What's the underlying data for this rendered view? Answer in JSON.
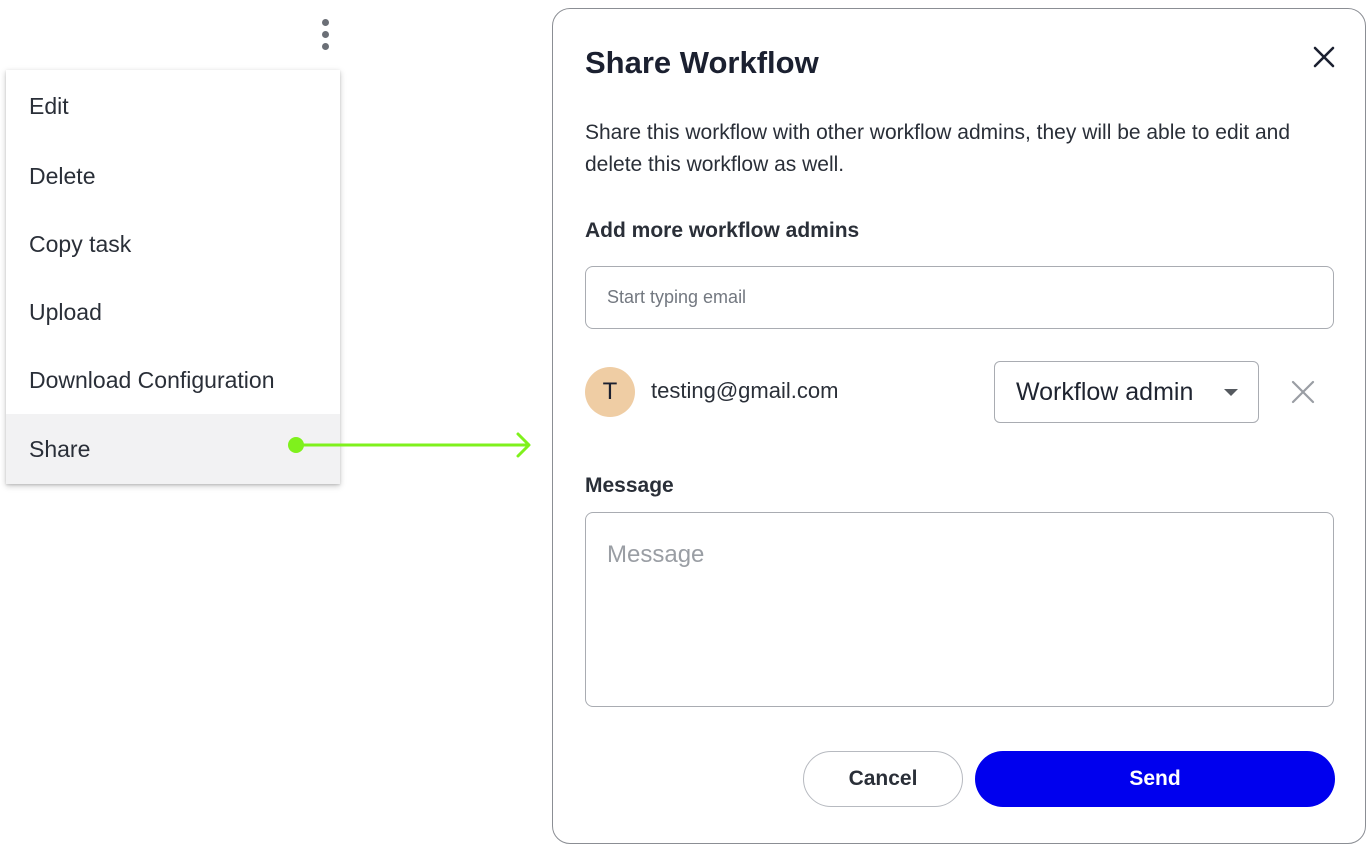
{
  "menu": {
    "items": [
      {
        "label": "Edit"
      },
      {
        "label": "Delete"
      },
      {
        "label": "Copy task"
      },
      {
        "label": "Upload"
      },
      {
        "label": "Download Configuration"
      },
      {
        "label": "Share"
      }
    ],
    "active_item": "Share"
  },
  "dialog": {
    "title": "Share Workflow",
    "description": "Share this workflow with other workflow admins, they will be able to edit and delete this workflow as well.",
    "admins_label": "Add more workflow admins",
    "email_placeholder": "Start typing email",
    "user": {
      "initial": "T",
      "email": "testing@gmail.com",
      "role": "Workflow admin"
    },
    "message_label": "Message",
    "message_placeholder": "Message",
    "cancel_label": "Cancel",
    "send_label": "Send"
  },
  "colors": {
    "primary": "#0000ee",
    "connector": "#7ff11c",
    "avatar": "#efcda4",
    "menu_active": "#f2f2f3"
  },
  "icons": {
    "kebab": "more-vertical-icon",
    "close": "close-icon",
    "remove": "remove-user-icon",
    "caret": "chevron-down-icon"
  }
}
